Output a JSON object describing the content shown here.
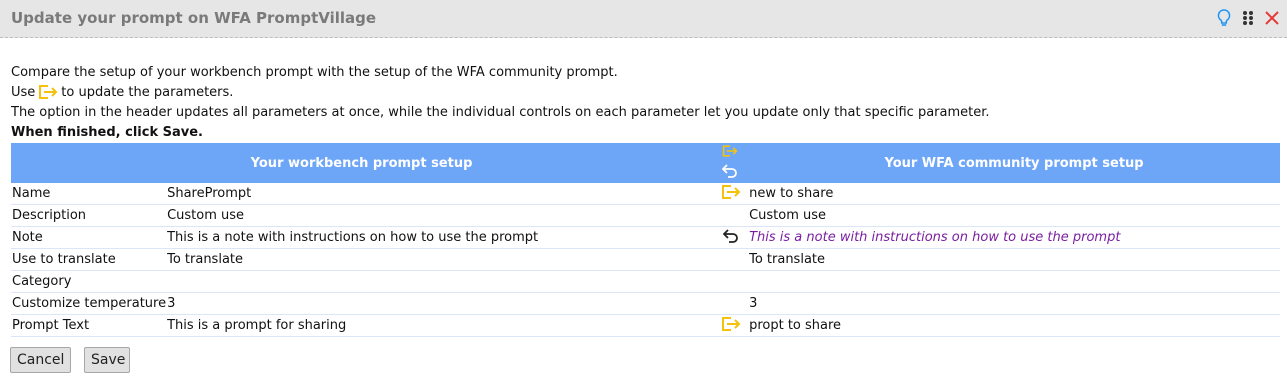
{
  "window": {
    "title": "Update your prompt on WFA PromptVillage",
    "icons": [
      "lightbulb-icon",
      "drag-grip-icon",
      "close-icon"
    ],
    "accent_color": "#f4c20d",
    "close_color": "#e53935",
    "info_color": "#2196f3"
  },
  "intro": {
    "line1": "Compare the setup of your workbench prompt with the setup of the WFA community prompt.",
    "line2_before": "Use",
    "line2_after": "to update the parameters.",
    "line3": "The option in the header updates all parameters at once, while the individual controls on each parameter let you update only that specific parameter.",
    "line4": "When finished, click Save."
  },
  "table": {
    "header_left": "Your workbench prompt setup",
    "header_right": "Your WFA community prompt setup",
    "header_color": "#6ea6f7",
    "rows": [
      {
        "name": "Name",
        "workbench": "SharePrompt",
        "control": "export",
        "community": "new to share",
        "community_style": "normal"
      },
      {
        "name": "Description",
        "workbench": "Custom use",
        "control": "",
        "community": "Custom use",
        "community_style": "normal"
      },
      {
        "name": "Note",
        "workbench": "This is a note with instructions on how to use the prompt",
        "control": "undo",
        "community": "This is a note with instructions on how to use the prompt",
        "community_style": "italic-purple"
      },
      {
        "name": "Use to translate",
        "workbench": "To translate",
        "control": "",
        "community": "To translate",
        "community_style": "normal"
      },
      {
        "name": "Category",
        "workbench": "",
        "control": "",
        "community": "",
        "community_style": "normal"
      },
      {
        "name": "Customize temperature",
        "workbench": "3",
        "control": "",
        "community": "3",
        "community_style": "normal"
      },
      {
        "name": "Prompt Text",
        "workbench": "This is a prompt for sharing",
        "control": "export",
        "community": "propt to share",
        "community_style": "normal"
      }
    ]
  },
  "buttons": {
    "cancel": "Cancel",
    "save": "Save"
  }
}
